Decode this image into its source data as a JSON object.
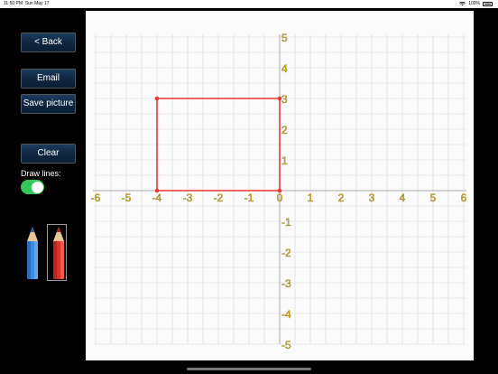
{
  "status_bar": {
    "time": "11:50 PM",
    "date": "Sun May 17",
    "battery": "100%"
  },
  "buttons": {
    "back": "< Back",
    "email": "Email",
    "save_picture": "Save picture",
    "clear": "Clear"
  },
  "draw_lines": {
    "label": "Draw lines:",
    "on": true
  },
  "pencils": [
    {
      "color": "blue",
      "hex": "#3a8de0",
      "selected": false
    },
    {
      "color": "red",
      "hex": "#e0302a",
      "selected": true
    }
  ],
  "graph": {
    "x_range": [
      -6,
      6
    ],
    "y_range": [
      -5,
      5
    ],
    "x_ticks": [
      "-6",
      "-5",
      "-4",
      "-3",
      "-2",
      "-1",
      "0",
      "1",
      "2",
      "3",
      "4",
      "5",
      "6"
    ],
    "y_ticks": [
      "5",
      "4",
      "3",
      "2",
      "1",
      "-1",
      "-2",
      "-3",
      "-4",
      "-5"
    ],
    "label_color": "#f4c20d",
    "polyline_color": "#e53935",
    "points": [
      [
        -4,
        3
      ],
      [
        0,
        3
      ],
      [
        0,
        0
      ],
      [
        -4,
        0
      ],
      [
        -4,
        3
      ]
    ]
  }
}
